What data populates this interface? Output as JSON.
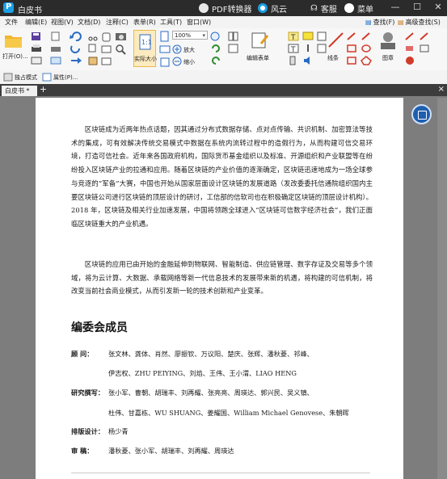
{
  "titlebar": {
    "app_title": "白皮书",
    "pdf_converter": "PDF转换器",
    "fengyun": "风云",
    "service": "客服",
    "menu": "菜单"
  },
  "menubar": {
    "items": [
      "文件",
      "编辑(E)",
      "视图(V)",
      "文档(D)",
      "注释(C)",
      "表单(R)",
      "工具(T)",
      "窗口(W)"
    ],
    "search_label": "查找(F)",
    "advanced_search_label": "高级查找(S)"
  },
  "ribbon": {
    "open_label": "打开(O)...",
    "actual_size_label": "实际大小",
    "zoom_value": "100%",
    "zoom_in_label": "放大",
    "zoom_out_label": "缩小",
    "edit_form_label": "编辑表单",
    "line_label": "线条",
    "stamp_label": "图章"
  },
  "subbar": {
    "solo_mode_label": "独占模式",
    "properties_label": "属性(P)..."
  },
  "tabs": {
    "doc_tab_label": "白皮书 *"
  },
  "document": {
    "para1": "区块链成为近两年热点话题，因其通过分布式数据存储、点对点传输、共识机制、加密算法等技术的集成，可有效解决传统交易模式中数据在系统内流转过程中的造假行为，从而构建可信交易环境，打造可信社会。近年来各国政府机构，国际货币基金组织以及标准、开源组织和产业联盟等在纷纷投入区块链产业的拉通和应用。随着区块链的产业价值的逐渐确定，区块链迅速地成为一场全球参与竞逐的“军备”大赛，中国也开始从国家层面设计区块链的发展道路（发改委委托信通院组织国内主要区块链公司进行区块链的顶层设计的研讨，工信部的信软司也在积极确定区块链的顶层设计机构）。2018 年，区块链及相关行业加速发展，中国将领跑全球进入“区块链可信数字经济社会”，我们正面临区块链重大的产业机遇。",
    "para2": "区块链的应用已由开始的金融延伸到物联网、智能制造、供应链管理、数字存证及交易等多个领域，将为云计算、大数据、承载网络等新一代信息技术的发展带来新的机遇，将构建的可信机制，将改变当前社会商业模式，从而引发新一轮的技术创新和产业变革。",
    "heading": "编委会成员",
    "members": [
      {
        "label": "顾    问：",
        "line1": "张文林、龚体、肖然、廖振钦、万议阳、楚庆、张辉、潘秋菱、祁峰、",
        "line2": "伊志权、ZHU PEIYING、刘焰、王伟、王小渭、LIAO HENG"
      },
      {
        "label": "研究撰写：",
        "line1": "张小军、曹朝、胡瑞丰、刘再耀、张亮亮、周瑛达、郭兴民、吴义镇、",
        "line2": "杜伟、甘嘉栋、WU SHUANG、姜耀国、William Michael Genovese、朱朝晖"
      },
      {
        "label": "排版设计：",
        "line1": "杨少青",
        "line2": ""
      },
      {
        "label": "审    稿：",
        "line1": "潘秋菱、张小军、胡瑞丰、刘再耀、周瑛达",
        "line2": ""
      }
    ]
  },
  "colors": {
    "titlebar_bg": "#2b2b2b",
    "accent_blue": "#1f5fb0",
    "active_orange": "#e8b84a"
  }
}
